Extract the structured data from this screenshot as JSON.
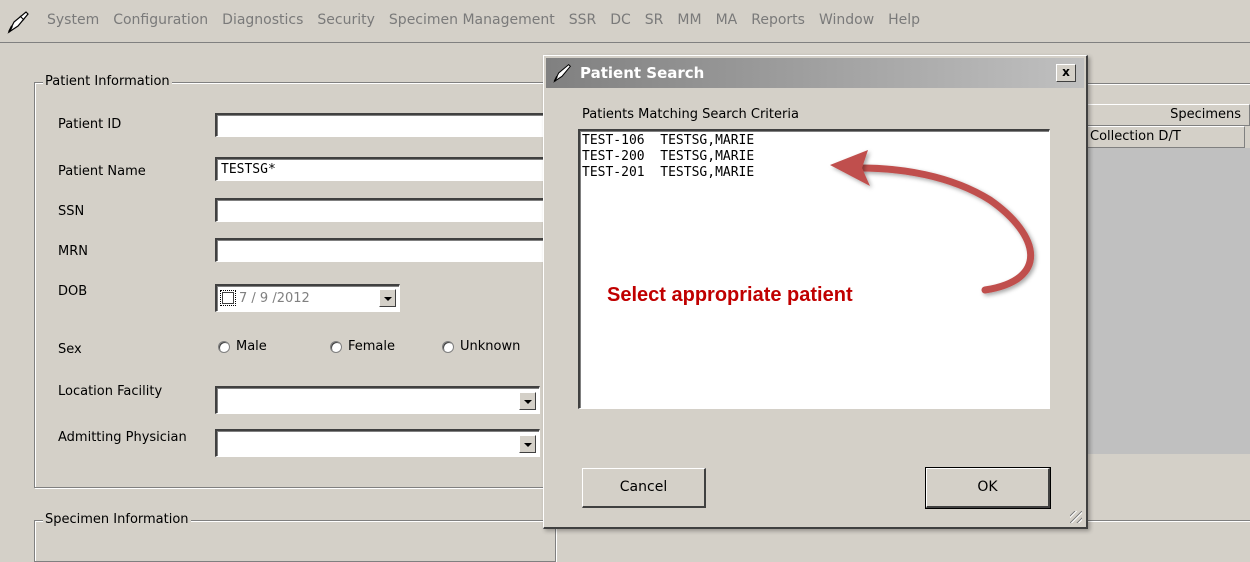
{
  "menubar": {
    "items": [
      "System",
      "Configuration",
      "Diagnostics",
      "Security",
      "Specimen Management",
      "SSR",
      "DC",
      "SR",
      "MM",
      "MA",
      "Reports",
      "Window",
      "Help"
    ]
  },
  "patient_info": {
    "group_title": "Patient Information",
    "patient_id_label": "Patient ID",
    "patient_id_value": "",
    "patient_name_label": "Patient Name",
    "patient_name_value": "TESTSG*",
    "ssn_label": "SSN",
    "ssn_value": "",
    "mrn_label": "MRN",
    "mrn_value": "",
    "dob_label": "DOB",
    "dob_value": "7 / 9 /2012",
    "sex_label": "Sex",
    "sex_options": [
      "Male",
      "Female",
      "Unknown"
    ],
    "location_label": "Location Facility",
    "location_value": "",
    "physician_label": "Admitting Physician",
    "physician_value": ""
  },
  "specimen_info": {
    "group_title": "Specimen Information"
  },
  "specimens_panel": {
    "header": "Specimens",
    "column": "Collection D/T"
  },
  "dialog": {
    "title": "Patient Search",
    "close_label": "x",
    "list_label": "Patients Matching Search Criteria",
    "results": [
      {
        "id": "TEST-106",
        "name": "TESTSG,MARIE"
      },
      {
        "id": "TEST-200",
        "name": "TESTSG,MARIE"
      },
      {
        "id": "TEST-201",
        "name": "TESTSG,MARIE"
      }
    ],
    "cancel_label": "Cancel",
    "ok_label": "OK"
  },
  "annotation": {
    "text": "Select appropriate patient",
    "color": "#c00000"
  }
}
